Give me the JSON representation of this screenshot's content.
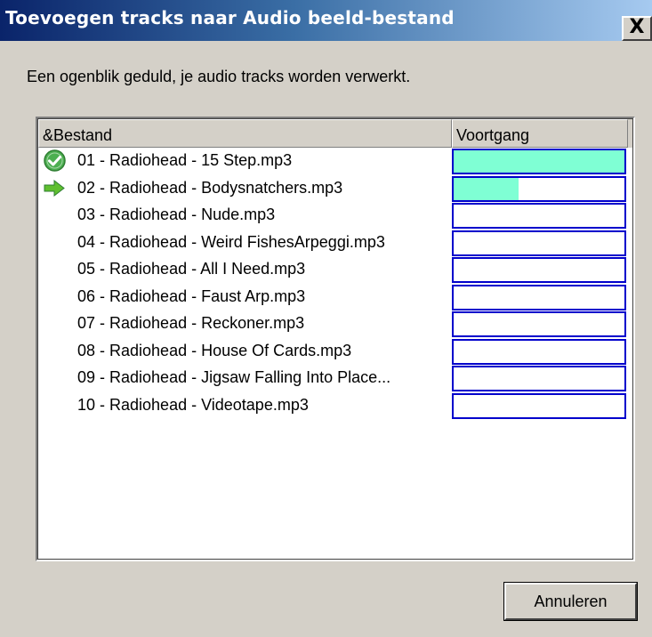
{
  "window": {
    "title": "Toevoegen tracks naar Audio beeld-bestand",
    "close_label": "X"
  },
  "message": "Een ogenblik geduld, je audio tracks worden verwerkt.",
  "list": {
    "columns": [
      "&Bestand",
      "Voortgang"
    ],
    "rows": [
      {
        "name": "01 - Radiohead - 15 Step.mp3",
        "status_icon": "check-circle-icon",
        "progress": 1.0
      },
      {
        "name": "02 - Radiohead - Bodysnatchers.mp3",
        "status_icon": "arrow-right-icon",
        "progress": 0.38
      },
      {
        "name": "03 - Radiohead - Nude.mp3",
        "status_icon": "",
        "progress": 0
      },
      {
        "name": "04 - Radiohead - Weird FishesArpeggi.mp3",
        "status_icon": "",
        "progress": 0
      },
      {
        "name": "05 - Radiohead - All I Need.mp3",
        "status_icon": "",
        "progress": 0
      },
      {
        "name": "06 - Radiohead - Faust Arp.mp3",
        "status_icon": "",
        "progress": 0
      },
      {
        "name": "07 - Radiohead - Reckoner.mp3",
        "status_icon": "",
        "progress": 0
      },
      {
        "name": "08 - Radiohead - House Of Cards.mp3",
        "status_icon": "",
        "progress": 0
      },
      {
        "name": "09 - Radiohead - Jigsaw Falling Into Place...",
        "status_icon": "",
        "progress": 0
      },
      {
        "name": "10 - Radiohead - Videotape.mp3",
        "status_icon": "",
        "progress": 0
      }
    ]
  },
  "buttons": {
    "cancel_label": "Annuleren"
  },
  "colors": {
    "progress_fill": "#7fffd4",
    "progress_border": "#0000cc",
    "check_green": "#4caf50",
    "arrow_green": "#5fbf2f"
  }
}
